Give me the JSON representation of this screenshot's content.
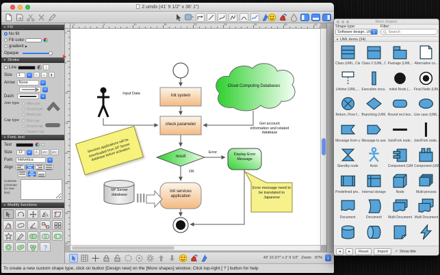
{
  "colors": {
    "accent": "#2f7cf6",
    "shape_fill": "#55a3d9",
    "flow_orange": "#f3ba82",
    "flow_green": "#2fd32f",
    "note_yellow": "#f6f27b"
  },
  "window": {
    "title": "2.umdx (41' 9 1/2\" x 36' 1\")",
    "status_bar": "To create a new custom shape type, click on button [Design new] on the [More shapes] window;  Click top-right [ ? ] button for help"
  },
  "toolbar": {
    "left_icons": [
      "new-document",
      "import-file",
      "cut",
      "delete",
      "edit-pen"
    ],
    "middle_icons": [
      "select-cursor",
      "shape-style-dropdown",
      "connector-elbow",
      "line-tool",
      "curve-tool",
      "polyline-tool",
      "arc-tool",
      "freehand",
      "pen-blue"
    ],
    "right_icons": [
      "emoji",
      "spray",
      "ink-drop",
      "panel-left",
      "panel-bottom",
      "panel-right"
    ]
  },
  "left_panel": {
    "fill": {
      "header": "Fill",
      "no_fill": "No fill",
      "fill_color": "Fill color",
      "gradient": "gradient",
      "gradient_arrow": "▶",
      "opaque": "Opaque"
    },
    "stroke": {
      "header": "Stroke",
      "line": "Line",
      "size_label": "Size",
      "size_value": "1",
      "arrow_label": "Arrow",
      "arrow_value": "None",
      "dash_label": "Dash",
      "join_label": "Join type",
      "join_options": [
        "Miter join",
        "Round join",
        "Bevel join"
      ],
      "cap_label": "Cap type",
      "cap_options": [
        "Butt cap",
        "Round cap",
        "Square cap"
      ]
    },
    "font": {
      "header": "Font, text",
      "text_label": "Text",
      "size_label": "Size",
      "size_value": "12",
      "font_label": "Font",
      "font_value": "Helvetica",
      "align_label": "Align",
      "contents_label": "Contents (Alt-Enter for new line)",
      "btn_a": "A",
      "btn_abc1": "abc",
      "btn_abc2": "abc"
    },
    "modify": {
      "header": "Modify functions",
      "icons": [
        "m-select",
        "m-rotate",
        "m-move",
        "m-mirror",
        "m-skew",
        "m-align-rotate",
        "m-shear",
        "m-angle",
        "m-connect",
        "m-grid",
        "m-star",
        "m-pen",
        "m-union",
        "m-intersect",
        "m-exclude",
        "m-subtract",
        "m-combine",
        "m-fragment",
        "m-help"
      ]
    }
  },
  "canvas": {
    "ruler_h": [
      0,
      5,
      10,
      15,
      20,
      25,
      30,
      35,
      40
    ],
    "ruler_v": [
      0,
      5,
      10,
      15,
      20,
      25,
      30,
      35
    ],
    "toolbar_icons": [
      "select-pointer",
      "grid",
      "crosshair",
      "lock",
      "unlock",
      "snap-circle-1",
      "snap-circle-2",
      "snap-circle-3",
      "nudge-up",
      "nudge-down",
      "emoji",
      "spray",
      "pen-blue"
    ],
    "dimensions": "43' 10 2/7\" x 2' 9 1/2\"",
    "zoom_label": "Zoom:",
    "zoom_value": "87%"
  },
  "flowchart": {
    "init_system": "Init system",
    "check_parameter": "check parameter",
    "input_data": "Input Data",
    "cloud": "Cloud Computing Databases",
    "cloud_note": "Get account information and related database",
    "result": "result",
    "error": "Error",
    "display_error": "Display Error Message",
    "ok": "OK",
    "init_services": "Init services application",
    "database": "SP Server database",
    "note": "Services applications will be downloaded from SP Server database before activation",
    "callout": "Error message need to be translated to Japanese"
  },
  "shapes_panel": {
    "title": "More shapes",
    "shape_type_label": "Shape type:",
    "shape_type_value": "Software design, UML",
    "filter_label": "Filter:",
    "search_placeholder": "Search",
    "section_header": "UML items (34)",
    "items": [
      {
        "label": "Class (UML, Cla...",
        "icon": "uml-class"
      },
      {
        "label": "Class 2 (UML, C...",
        "icon": "uml-class2"
      },
      {
        "label": "Package (UML, C...",
        "icon": "uml-package"
      },
      {
        "label": "Alternative co...",
        "icon": "uml-alternative"
      },
      {
        "label": "Lifeline (UML,...",
        "icon": "uml-lifeline"
      },
      {
        "label": "Execution occu...",
        "icon": "uml-execution"
      },
      {
        "label": "Initial Node (...",
        "icon": "uml-initial-node"
      },
      {
        "label": "Final Node (UM...",
        "icon": "uml-final-node"
      },
      {
        "label": "Return, Flow f...",
        "icon": "uml-return"
      },
      {
        "label": "Branching (UML...",
        "icon": "uml-branching"
      },
      {
        "label": "Round rect box...",
        "icon": "uml-round-rect"
      },
      {
        "label": "Use case (UML,...",
        "icon": "uml-use-case"
      },
      {
        "label": "Message from u...",
        "icon": "uml-message-from"
      },
      {
        "label": "Message to user",
        "icon": "uml-message-to"
      },
      {
        "label": "Join/Fork node...",
        "icon": "uml-join-fork-h"
      },
      {
        "label": "Join/Fork node...",
        "icon": "uml-join-fork-v"
      },
      {
        "label": "Standby node",
        "icon": "uml-standby"
      },
      {
        "label": "Actor",
        "icon": "uml-actor"
      },
      {
        "label": "Component (UML...",
        "icon": "uml-component"
      },
      {
        "label": "Component (UML...",
        "icon": "uml-component2"
      },
      {
        "label": "Predefined pro...",
        "icon": "uml-predefined"
      },
      {
        "label": "Internal storage",
        "icon": "uml-internal-storage"
      },
      {
        "label": "Node",
        "icon": "uml-node3d"
      },
      {
        "label": "Multi-process",
        "icon": "uml-multi-process"
      },
      {
        "label": "Document",
        "icon": "uml-document"
      },
      {
        "label": "Document",
        "icon": "uml-document2"
      },
      {
        "label": "Multi Document",
        "icon": "uml-multi-document"
      },
      {
        "label": "Multi Document",
        "icon": "uml-multi-document2"
      },
      {
        "label": "",
        "icon": "uml-database"
      },
      {
        "label": "",
        "icon": "uml-database-h"
      },
      {
        "label": "",
        "icon": "uml-page-curl"
      },
      {
        "label": "",
        "icon": "uml-lightning"
      }
    ],
    "footer": {
      "reset": "Reset",
      "import": "Import",
      "show_title": "Show title",
      "check": "✓",
      "prev": "◂",
      "next": "▸"
    }
  }
}
